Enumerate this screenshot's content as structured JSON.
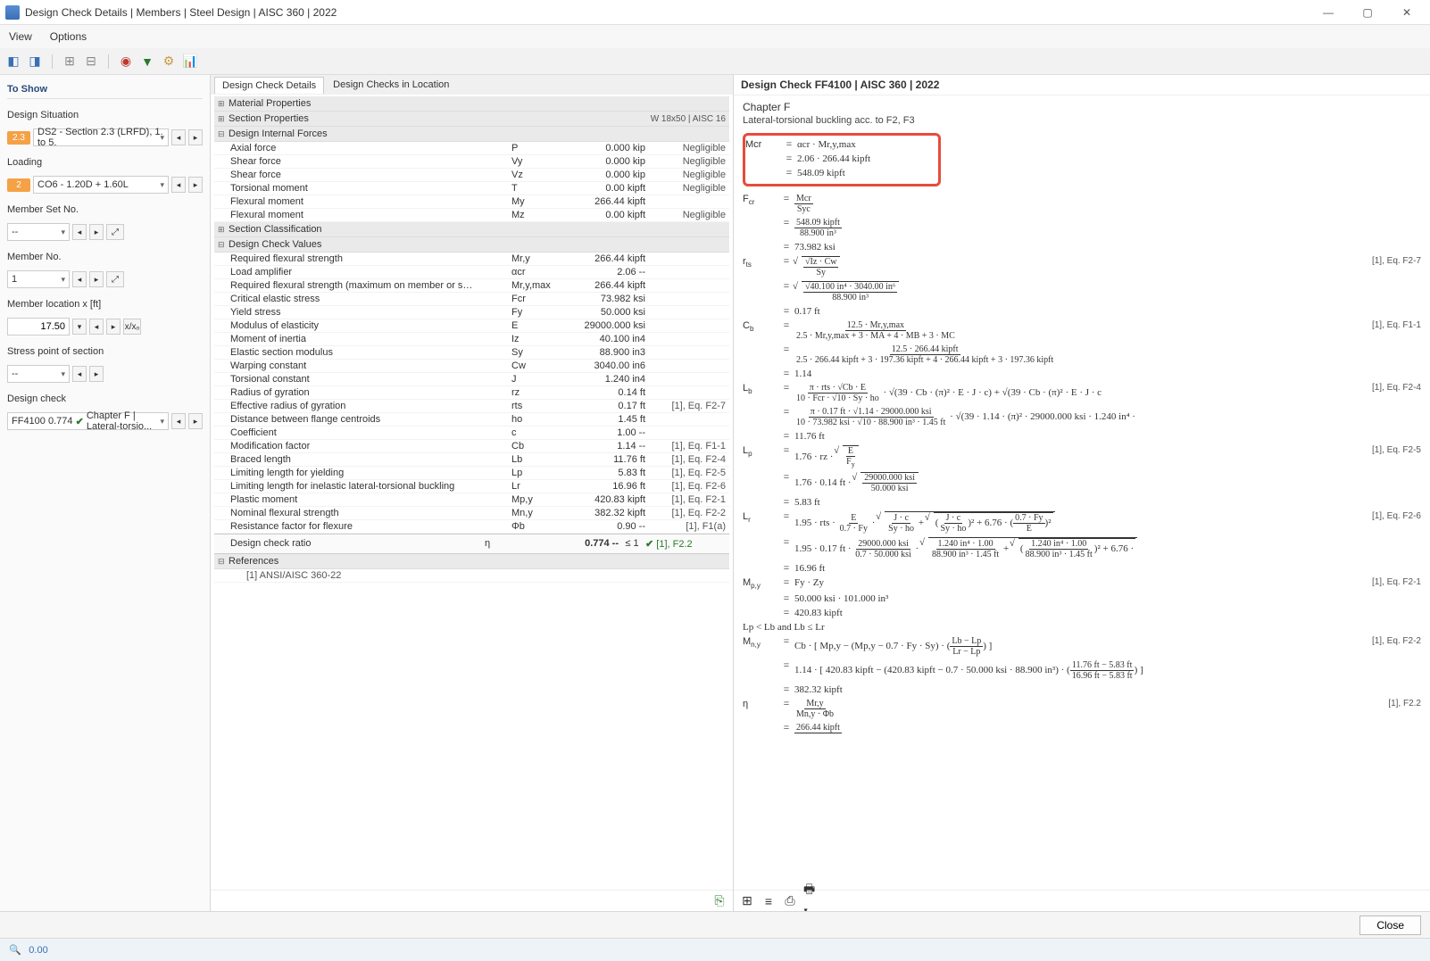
{
  "window": {
    "title": "Design Check Details | Members | Steel Design | AISC 360 | 2022"
  },
  "menu": {
    "view": "View",
    "options": "Options"
  },
  "left": {
    "header": "To Show",
    "designSituation": {
      "label": "Design Situation",
      "badge": "2.3",
      "value": "DS2 - Section 2.3 (LRFD), 1. to 5."
    },
    "loading": {
      "label": "Loading",
      "badge": "2",
      "value": "CO6 - 1.20D + 1.60L"
    },
    "memberSet": {
      "label": "Member Set No.",
      "value": "--"
    },
    "memberNo": {
      "label": "Member No.",
      "value": "1"
    },
    "memberLoc": {
      "label": "Member location x [ft]",
      "value": "17.50"
    },
    "stressPoint": {
      "label": "Stress point of section",
      "value": "--"
    },
    "designCheck": {
      "label": "Design check",
      "code": "FF4100",
      "ratio": "0.774",
      "desc": "Chapter F | Lateral-torsio..."
    }
  },
  "center": {
    "tabs": {
      "t1": "Design Check Details",
      "t2": "Design Checks in Location"
    },
    "sections": {
      "matProps": "Material Properties",
      "secProps": "Section Properties",
      "secPropsExtra": "W 18x50 | AISC 16",
      "internalForces": "Design Internal Forces",
      "secClass": "Section Classification",
      "checkValues": "Design Check Values",
      "references": "References"
    },
    "forces": [
      {
        "name": "Axial force",
        "sym": "P",
        "val": "0.000 kip",
        "note": "Negligible"
      },
      {
        "name": "Shear force",
        "sym": "Vy",
        "val": "0.000 kip",
        "note": "Negligible"
      },
      {
        "name": "Shear force",
        "sym": "Vz",
        "val": "0.000 kip",
        "note": "Negligible"
      },
      {
        "name": "Torsional moment",
        "sym": "T",
        "val": "0.00 kipft",
        "note": "Negligible"
      },
      {
        "name": "Flexural moment",
        "sym": "My",
        "val": "266.44 kipft",
        "note": ""
      },
      {
        "name": "Flexural moment",
        "sym": "Mz",
        "val": "0.00 kipft",
        "note": "Negligible"
      }
    ],
    "checks": [
      {
        "name": "Required flexural strength",
        "sym": "Mr,y",
        "val": "266.44 kipft",
        "ref": ""
      },
      {
        "name": "Load amplifier",
        "sym": "αcr",
        "val": "2.06 --",
        "ref": ""
      },
      {
        "name": "Required flexural strength (maximum on member or s…",
        "sym": "Mr,y,max",
        "val": "266.44 kipft",
        "ref": ""
      },
      {
        "name": "Critical elastic stress",
        "sym": "Fcr",
        "val": "73.982 ksi",
        "ref": ""
      },
      {
        "name": "Yield stress",
        "sym": "Fy",
        "val": "50.000 ksi",
        "ref": ""
      },
      {
        "name": "Modulus of elasticity",
        "sym": "E",
        "val": "29000.000 ksi",
        "ref": ""
      },
      {
        "name": "Moment of inertia",
        "sym": "Iz",
        "val": "40.100 in4",
        "ref": ""
      },
      {
        "name": "Elastic section modulus",
        "sym": "Sy",
        "val": "88.900 in3",
        "ref": ""
      },
      {
        "name": "Warping constant",
        "sym": "Cw",
        "val": "3040.00 in6",
        "ref": ""
      },
      {
        "name": "Torsional constant",
        "sym": "J",
        "val": "1.240 in4",
        "ref": ""
      },
      {
        "name": "Radius of gyration",
        "sym": "rz",
        "val": "0.14 ft",
        "ref": ""
      },
      {
        "name": "Effective radius of gyration",
        "sym": "rts",
        "val": "0.17 ft",
        "ref": "[1], Eq. F2-7"
      },
      {
        "name": "Distance between flange centroids",
        "sym": "ho",
        "val": "1.45 ft",
        "ref": ""
      },
      {
        "name": "Coefficient",
        "sym": "c",
        "val": "1.00 --",
        "ref": ""
      },
      {
        "name": "Modification factor",
        "sym": "Cb",
        "val": "1.14 --",
        "ref": "[1], Eq. F1-1"
      },
      {
        "name": "Braced length",
        "sym": "Lb",
        "val": "11.76 ft",
        "ref": "[1], Eq. F2-4"
      },
      {
        "name": "Limiting length for yielding",
        "sym": "Lp",
        "val": "5.83 ft",
        "ref": "[1], Eq. F2-5"
      },
      {
        "name": "Limiting length for inelastic lateral-torsional buckling",
        "sym": "Lr",
        "val": "16.96 ft",
        "ref": "[1], Eq. F2-6"
      },
      {
        "name": "Plastic moment",
        "sym": "Mp,y",
        "val": "420.83 kipft",
        "ref": "[1], Eq. F2-1"
      },
      {
        "name": "Nominal flexural strength",
        "sym": "Mn,y",
        "val": "382.32 kipft",
        "ref": "[1], Eq. F2-2"
      },
      {
        "name": "Resistance factor for flexure",
        "sym": "Φb",
        "val": "0.90 --",
        "ref": "[1], F1(a)"
      }
    ],
    "ratio": {
      "name": "Design check ratio",
      "sym": "η",
      "val": "0.774 --",
      "lim": "≤ 1",
      "ref": "[1], F2.2"
    },
    "refText": "[1]  ANSI/AISC 360-22"
  },
  "right": {
    "title": "Design Check FF4100 | AISC 360 | 2022",
    "chF": "Chapter F",
    "chSub": "Lateral-torsional buckling acc. to F2, F3",
    "mcr": {
      "sym": "Mcr",
      "e1": "αcr  ·  Mr,y,max",
      "e2": "2.06  ·  266.44 kipft",
      "e3": "548.09 kipft"
    },
    "fcr_frac": {
      "num": "Mcr",
      "den": "Syc"
    },
    "fcr_frac2": {
      "num": "548.09 kipft",
      "den": "88.900 in³"
    },
    "fcr_val": "73.982 ksi",
    "rts_ref": "[1], Eq. F2-7",
    "rts_sqrt_num": "√Iz · Cw",
    "rts_sqrt_den": "Sy",
    "rts_num2": "√40.100 in⁴ · 3040.00 in⁶",
    "rts_den2": "88.900 in³",
    "rts_val": "0.17 ft",
    "cb_ref": "[1], Eq. F1-1",
    "cb_num": "12.5  ·  Mr,y,max",
    "cb_den": "2.5 · Mr,y,max  +  3 · MA  +  4 · MB  +  3 · MC",
    "cb_num2": "12.5  ·  266.44 kipft",
    "cb_den2": "2.5 · 266.44 kipft  +  3 · 197.36 kipft  +  4 · 266.44 kipft  +  3 · 197.36 kipft",
    "cb_val": "1.14",
    "lb_ref": "[1], Eq. F2-4",
    "lb_e1": "π · rts · √Cb · E",
    "lb_e1d": "10 · Fcr · √10 · Sy · ho",
    "lb_e1tail": "√(39 · Cb · (π)² · E · J · c)  +  √(39 · Cb · (π)² · E · J · c",
    "lb_e2": "π · 0.17 ft · √1.14 · 29000.000 ksi",
    "lb_e2d": "10 · 73.982 ksi · √10 · 88.900 in³ · 1.45 ft",
    "lb_e2tail": "√(39 · 1.14 · (π)² · 29000.000 ksi · 1.240 in⁴ · ",
    "lb_val": "11.76 ft",
    "lp_ref": "[1], Eq. F2-5",
    "lp_e1": "1.76  ·  rz  ·  ",
    "lp_sqrt": "E / Fy",
    "lp_e2": "1.76  ·  0.14 ft  ·  ",
    "lp_sqrt2_num": "29000.000 ksi",
    "lp_sqrt2_den": "50.000 ksi",
    "lp_val": "5.83 ft",
    "lr_ref": "[1], Eq. F2-6",
    "lr_e1a": "1.95 · rts · ",
    "lr_e1b_num": "E",
    "lr_e1b_den": "0.7 · Fy",
    "lr_sqrt1_num": "J · c",
    "lr_sqrt1_den": "Sy · ho",
    "lr_sqrt2": "+ 6.76 ·",
    "lr_tail_num": "0.7 · Fy",
    "lr_tail_den": "E",
    "lr_e2a": "1.95 · 0.17 ft · ",
    "lr_e2b_num": "29000.000 ksi",
    "lr_e2b_den": "0.7 · 50.000 ksi",
    "lr_e2_s1_num": "1.240 in⁴ · 1.00",
    "lr_e2_s1_den": "88.900 in³ · 1.45 ft",
    "lr_val": "16.96 ft",
    "mpy_ref": "[1], Eq. F2-1",
    "mpy_e1": "Fy  ·  Zy",
    "mpy_e2": "50.000 ksi  ·  101.000 in³",
    "mpy_val": "420.83 kipft",
    "cond": "Lp  <  Lb and Lb  ≤  Lr",
    "mny_ref": "[1], Eq. F2-2",
    "mny_e1": "Cb · [ Mp,y  −  (Mp,y  −  0.7 · Fy · Sy) · ",
    "mny_frac_num": "Lb − Lp",
    "mny_frac_den": "Lr − Lp",
    "mny_e2": "1.14 · [ 420.83 kipft  −  (420.83 kipft  −  0.7 · 50.000 ksi · 88.900 in³) · ",
    "mny_frac2_num": "11.76 ft − 5.83 ft",
    "mny_frac2_den": "16.96 ft − 5.83 ft",
    "mny_val": "382.32 kipft",
    "eta_ref": "[1], F2.2",
    "eta_num": "Mr,y",
    "eta_den": "Mn,y · Φb",
    "eta_num2": "266.44 kipft"
  },
  "footer": {
    "close": "Close"
  }
}
